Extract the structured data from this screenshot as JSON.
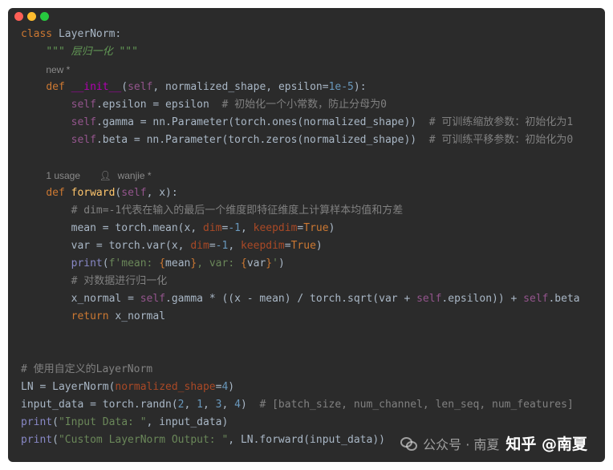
{
  "window": {
    "buttons": {
      "close": "#ff5f56",
      "minimize": "#ffbd2e",
      "zoom": "#27c93f"
    }
  },
  "hints": {
    "new": "new *",
    "usage": "1 usage",
    "author": "wanjie *"
  },
  "code": {
    "l1_kw": "class",
    "l1_name": "LayerNorm",
    "l1_end": ":",
    "l2_doc": "\"\"\" 层归一化 \"\"\"",
    "l3_kw": "def",
    "l3_fn": "__init__",
    "l3_self": "self",
    "l3_arg1": "normalized_shape",
    "l3_arg2": "epsilon",
    "l3_default": "1e-5",
    "l4_attr": "epsilon",
    "l4_rhs": "epsilon",
    "l4_cm": "# 初始化一个小常数，防止分母为0",
    "l5_attr": "gamma",
    "l5_rhs": "nn.Parameter(torch.ones(normalized_shape))",
    "l5_cm": "# 可训练缩放参数：初始化为1",
    "l6_attr": "beta",
    "l6_rhs": "nn.Parameter(torch.zeros(normalized_shape))",
    "l6_cm": "# 可训练平移参数：初始化为0",
    "l7_kw": "def",
    "l7_fn": "forward",
    "l7_self": "self",
    "l7_arg": "x",
    "l8_cm": "# dim=-1代表在输入的最后一个维度即特征维度上计算样本均值和方差",
    "l9_lhs": "mean = torch.mean(x, ",
    "l9_kw1": "dim",
    "l9_val1": "-1",
    "l9_kw2": "keepdim",
    "l9_val2": "True",
    "l10_lhs": "var = torch.var(x, ",
    "l10_kw1": "dim",
    "l10_val1": "-1",
    "l10_kw2": "keepdim",
    "l10_val2": "True",
    "l11_fn": "print",
    "l11_s1": "f'mean: ",
    "l11_v1": "mean",
    "l11_s2": ", var: ",
    "l11_v2": "var",
    "l11_s3": "'",
    "l12_cm": "# 对数据进行归一化",
    "l13_lhs": "x_normal = ",
    "l13_self1": "self",
    "l13_mid": ".gamma * ((x - mean) / torch.sqrt(var + ",
    "l13_self2": "self",
    "l13_mid2": ".epsilon)) + ",
    "l13_self3": "self",
    "l13_end": ".beta",
    "l14_kw": "return",
    "l14_val": "x_normal",
    "l15_cm": "# 使用自定义的LayerNorm",
    "l16_lhs": "LN = LayerNorm(",
    "l16_kw": "normalized_shape",
    "l16_val": "4",
    "l17_lhs": "input_data = torch.randn(",
    "l17_n1": "2",
    "l17_n2": "1",
    "l17_n3": "3",
    "l17_n4": "4",
    "l17_cm": "# [batch_size, num_channel, len_seq, num_features]",
    "l18_fn": "print",
    "l18_str": "\"Input Data: \"",
    "l18_arg": "input_data",
    "l19_fn": "print",
    "l19_str": "\"Custom LayerNorm Output: \"",
    "l19_arg": "LN.forward(input_data)"
  },
  "watermark": {
    "wechat": "公众号 · 南夏",
    "zhihu": "知乎 @南夏"
  }
}
